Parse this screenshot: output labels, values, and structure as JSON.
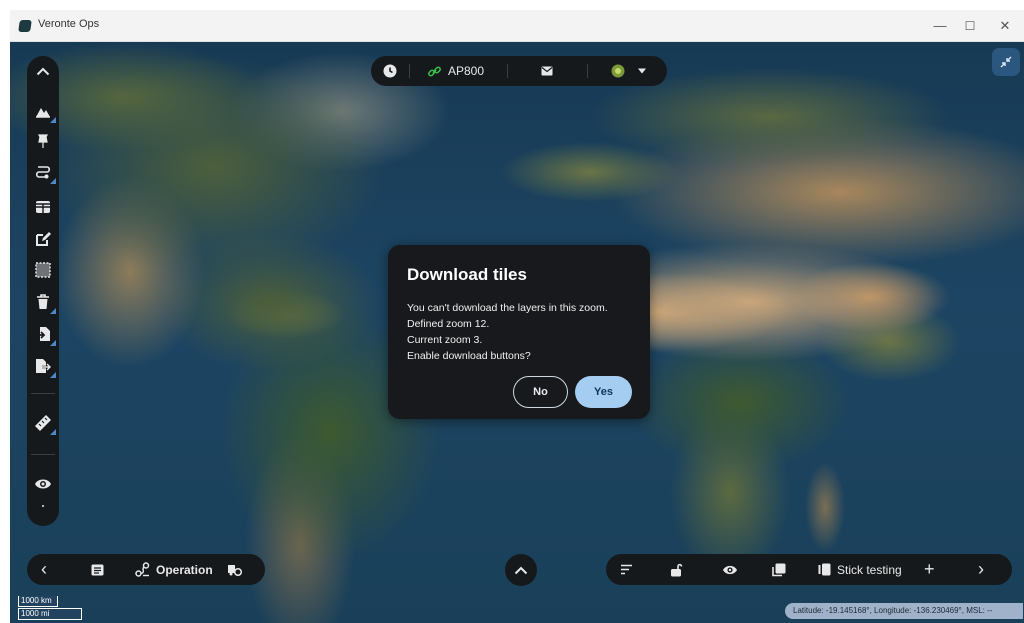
{
  "window": {
    "title": "Veronte Ops",
    "minimize_glyph": "—",
    "maximize_glyph": "☐",
    "close_glyph": "✕"
  },
  "top_bar": {
    "clock_icon": "clock-icon",
    "link_icon": "link-icon",
    "autopilot_label": "AP800",
    "mail_icon": "mail-icon",
    "status_icon": "status-orb-icon",
    "dropdown_icon": "caret-down-icon"
  },
  "left_toolbar": {
    "items": [
      {
        "icon": "chevron-up-icon",
        "glyph": "⌃"
      },
      {
        "icon": "mountain-icon",
        "glyph": "▲"
      },
      {
        "icon": "pin-icon",
        "glyph": "📌"
      },
      {
        "icon": "route-icon",
        "glyph": "⇆"
      },
      {
        "icon": "grid-icon",
        "glyph": "⊞"
      },
      {
        "icon": "edit-icon",
        "glyph": "✎"
      },
      {
        "icon": "selection-icon",
        "glyph": "⬚"
      },
      {
        "icon": "trash-icon",
        "glyph": "🗑"
      },
      {
        "icon": "import-icon",
        "glyph": "⇲"
      },
      {
        "icon": "export-icon",
        "glyph": "⇱"
      },
      {
        "icon": "ruler-icon",
        "glyph": "📏"
      },
      {
        "icon": "eye-icon",
        "glyph": "◉"
      }
    ]
  },
  "bottom_left_bar": {
    "back_glyph": "‹",
    "list_icon": "list-icon",
    "operation_label": "Operation",
    "vehicle_icon": "vehicle-icon"
  },
  "bottom_right_bar": {
    "sort_icon": "sort-icon",
    "unlock_icon": "unlock-icon",
    "eye_icon": "eye-icon",
    "layers_icon": "layers-icon",
    "panel_label": "Stick testing",
    "add_glyph": "+",
    "next_glyph": "›"
  },
  "center_up_glyph": "⌃",
  "scale_bar": {
    "km": "1000 km",
    "mi": "1000 mi"
  },
  "status": {
    "coordinates": "Latitude: -19.145168°, Longitude: -136.230469°, MSL: --"
  },
  "dialog": {
    "title": "Download tiles",
    "lines": [
      "You can't download the layers in this zoom.",
      "Defined zoom 12.",
      "Current zoom 3.",
      "Enable download buttons?"
    ],
    "no_label": "No",
    "yes_label": "Yes"
  },
  "colors": {
    "toolbar_bg": "#16191c",
    "accent_blue": "#4d88c9",
    "yes_button": "#a4cdf1",
    "map_ocean": "#1d4563"
  }
}
